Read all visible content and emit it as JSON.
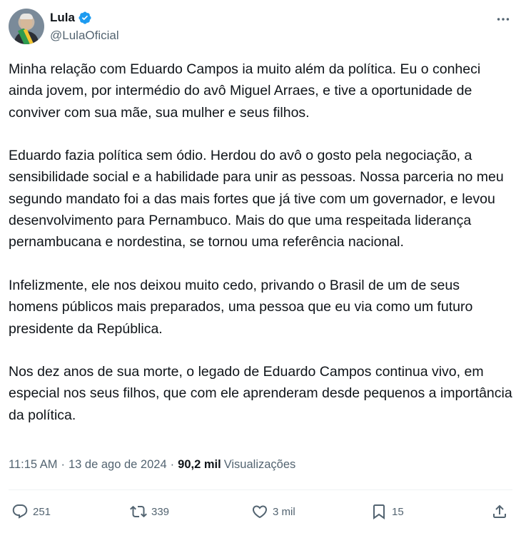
{
  "author": {
    "display_name": "Lula",
    "handle": "@LulaOficial",
    "verified": true,
    "verified_color": "#1d9bf0"
  },
  "tweet": {
    "paragraphs": [
      "Minha relação com Eduardo Campos ia muito além da política. Eu o conheci ainda jovem, por intermédio do avô Miguel Arraes, e tive a oportunidade de conviver com sua mãe, sua mulher e seus filhos.",
      "Eduardo fazia política sem ódio. Herdou do avô o gosto pela negociação, a sensibilidade social e a habilidade para unir as pessoas. Nossa parceria no meu segundo mandato foi a das mais fortes que já tive com um governador, e levou desenvolvimento para Pernambuco. Mais do que uma respeitada liderança pernambucana e nordestina, se tornou uma referência nacional.",
      "Infelizmente, ele nos deixou muito cedo, privando o Brasil de um de seus homens públicos mais preparados, uma pessoa que eu via como um futuro presidente da República.",
      "Nos dez anos de sua morte, o legado de Eduardo Campos continua vivo, em especial nos seus filhos, que com ele aprenderam desde pequenos a importância da política."
    ]
  },
  "meta": {
    "time": "11:15 AM",
    "date": "13 de ago de 2024",
    "views_count": "90,2 mil",
    "views_label": "Visualizações"
  },
  "actions": {
    "replies": "251",
    "reposts": "339",
    "likes": "3 mil",
    "bookmarks": "15"
  },
  "icons": {
    "more": "more-horizontal-icon",
    "reply": "reply-icon",
    "retweet": "retweet-icon",
    "like": "heart-icon",
    "bookmark": "bookmark-icon",
    "share": "share-icon"
  }
}
